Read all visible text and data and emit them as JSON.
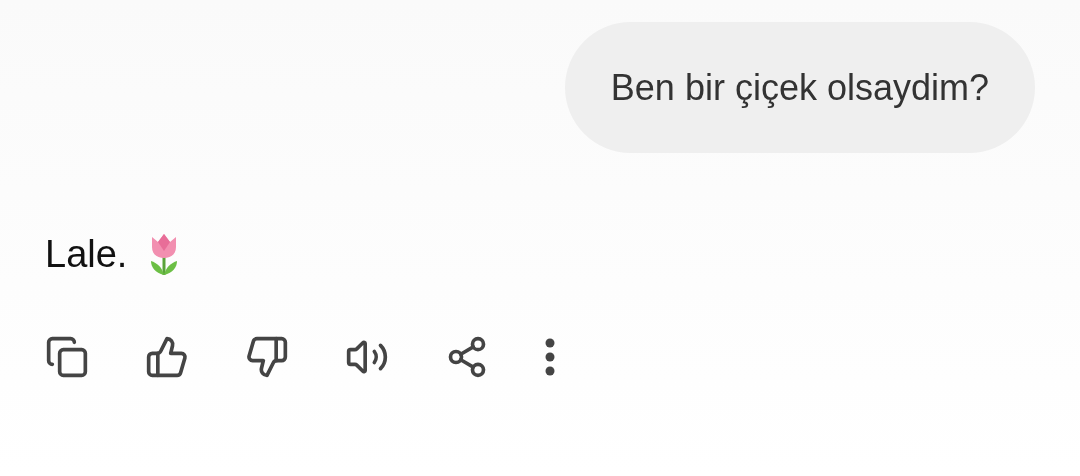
{
  "user_message": {
    "text": "Ben bir çiçek olsaydim?"
  },
  "reply": {
    "text": "Lale."
  },
  "actions": [
    {
      "kind": "copy"
    },
    {
      "kind": "like"
    },
    {
      "kind": "dislike"
    },
    {
      "kind": "speak"
    },
    {
      "kind": "share"
    },
    {
      "kind": "more"
    }
  ]
}
